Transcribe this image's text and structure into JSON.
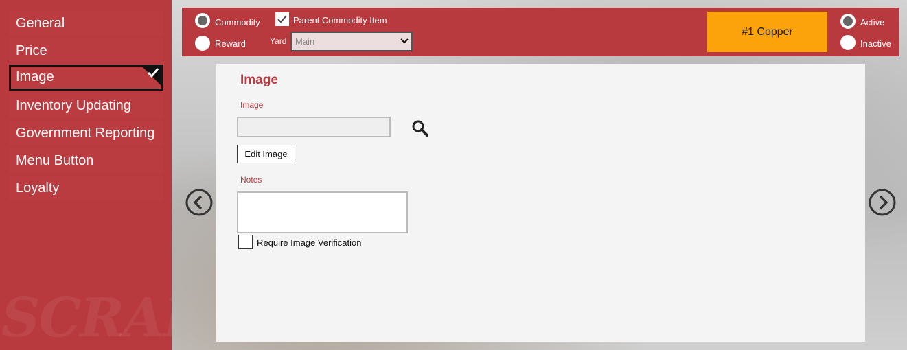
{
  "sidebar": {
    "items": [
      {
        "label": "General"
      },
      {
        "label": "Price"
      },
      {
        "label": "Image",
        "active": true
      },
      {
        "label": "Inventory Updating"
      },
      {
        "label": "Government Reporting"
      },
      {
        "label": "Menu Button"
      },
      {
        "label": "Loyalty"
      }
    ],
    "watermark": "SCRAP"
  },
  "topbar": {
    "type_options": [
      {
        "label": "Commodity",
        "selected": true
      },
      {
        "label": "Reward",
        "selected": false
      }
    ],
    "parent_commodity": {
      "label": "Parent Commodity Item",
      "checked": true
    },
    "yard": {
      "label": "Yard",
      "value": "Main"
    },
    "item_name": "#1 Copper",
    "status_options": [
      {
        "label": "Active",
        "selected": true
      },
      {
        "label": "Inactive",
        "selected": false
      }
    ]
  },
  "panel": {
    "title": "Image",
    "image_label": "Image",
    "image_value": "",
    "edit_button": "Edit Image",
    "notes_label": "Notes",
    "notes_value": "",
    "verify": {
      "label": "Require Image Verification",
      "checked": false
    }
  },
  "colors": {
    "brand": "#b8393e",
    "badge": "#fca20b"
  },
  "icons": {
    "search": "magnifier-icon",
    "prev": "chevron-left-circle-icon",
    "next": "chevron-right-circle-icon"
  }
}
